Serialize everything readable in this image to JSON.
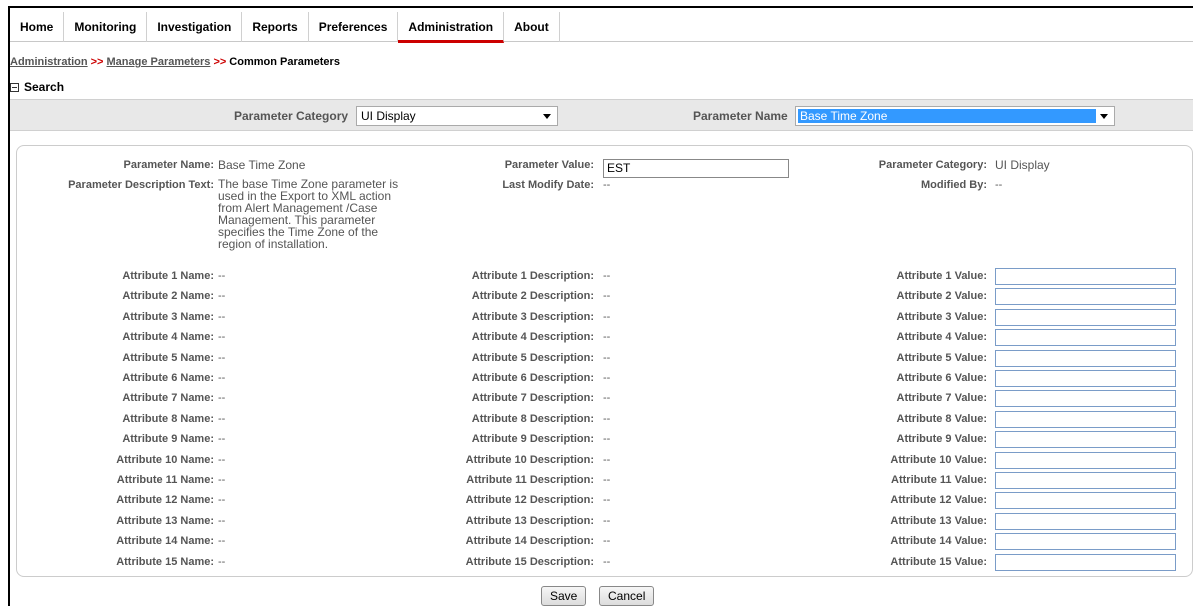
{
  "nav": {
    "items": [
      {
        "label": "Home"
      },
      {
        "label": "Monitoring"
      },
      {
        "label": "Investigation"
      },
      {
        "label": "Reports"
      },
      {
        "label": "Preferences"
      },
      {
        "label": "Administration",
        "active": true
      },
      {
        "label": "About"
      }
    ]
  },
  "breadcrumb": {
    "items": [
      "Administration",
      "Manage Parameters"
    ],
    "separator": ">>",
    "current": "Common Parameters"
  },
  "search": {
    "title": "Search",
    "category_label": "Parameter Category",
    "category_value": "UI Display",
    "name_label": "Parameter Name",
    "name_value": "Base Time Zone"
  },
  "details": {
    "param_name_label": "Parameter Name:",
    "param_name_value": "Base Time Zone",
    "param_value_label": "Parameter Value:",
    "param_value_value": "EST",
    "param_category_label": "Parameter Category:",
    "param_category_value": "UI Display",
    "desc_label": "Parameter Description Text:",
    "desc_value": "The base Time Zone parameter is used in the Export to XML action from Alert Management /Case Management. This parameter specifies the Time Zone of the region of installation.",
    "last_modify_label": "Last Modify Date:",
    "last_modify_value": "--",
    "modified_by_label": "Modified By:",
    "modified_by_value": "--"
  },
  "attributes": [
    {
      "name_label": "Attribute 1 Name:",
      "name_value": "--",
      "desc_label": "Attribute 1 Description:",
      "desc_value": "--",
      "value_label": "Attribute 1 Value:"
    },
    {
      "name_label": "Attribute 2 Name:",
      "name_value": "--",
      "desc_label": "Attribute 2 Description:",
      "desc_value": "--",
      "value_label": "Attribute 2 Value:"
    },
    {
      "name_label": "Attribute 3 Name:",
      "name_value": "--",
      "desc_label": "Attribute 3 Description:",
      "desc_value": "--",
      "value_label": "Attribute 3 Value:"
    },
    {
      "name_label": "Attribute 4 Name:",
      "name_value": "--",
      "desc_label": "Attribute 4 Description:",
      "desc_value": "--",
      "value_label": "Attribute 4 Value:"
    },
    {
      "name_label": "Attribute 5 Name:",
      "name_value": "--",
      "desc_label": "Attribute 5 Description:",
      "desc_value": "--",
      "value_label": "Attribute 5 Value:"
    },
    {
      "name_label": "Attribute 6 Name:",
      "name_value": "--",
      "desc_label": "Attribute 6 Description:",
      "desc_value": "--",
      "value_label": "Attribute 6 Value:"
    },
    {
      "name_label": "Attribute 7 Name:",
      "name_value": "--",
      "desc_label": "Attribute 7 Description:",
      "desc_value": "--",
      "value_label": "Attribute 7 Value:"
    },
    {
      "name_label": "Attribute 8 Name:",
      "name_value": "--",
      "desc_label": "Attribute 8 Description:",
      "desc_value": "--",
      "value_label": "Attribute 8 Value:"
    },
    {
      "name_label": "Attribute 9 Name:",
      "name_value": "--",
      "desc_label": "Attribute 9 Description:",
      "desc_value": "--",
      "value_label": "Attribute 9 Value:"
    },
    {
      "name_label": "Attribute 10 Name:",
      "name_value": "--",
      "desc_label": "Attribute 10 Description:",
      "desc_value": "--",
      "value_label": "Attribute 10 Value:"
    },
    {
      "name_label": "Attribute 11 Name:",
      "name_value": "--",
      "desc_label": "Attribute 11 Description:",
      "desc_value": "--",
      "value_label": "Attribute 11 Value:"
    },
    {
      "name_label": "Attribute 12 Name:",
      "name_value": "--",
      "desc_label": "Attribute 12 Description:",
      "desc_value": "--",
      "value_label": "Attribute 12 Value:"
    },
    {
      "name_label": "Attribute 13 Name:",
      "name_value": "--",
      "desc_label": "Attribute 13 Description:",
      "desc_value": "--",
      "value_label": "Attribute 13 Value:"
    },
    {
      "name_label": "Attribute 14 Name:",
      "name_value": "--",
      "desc_label": "Attribute 14 Description:",
      "desc_value": "--",
      "value_label": "Attribute 14 Value:"
    },
    {
      "name_label": "Attribute 15 Name:",
      "name_value": "--",
      "desc_label": "Attribute 15 Description:",
      "desc_value": "--",
      "value_label": "Attribute 15 Value:"
    }
  ],
  "actions": {
    "save_label": "Save",
    "cancel_label": "Cancel"
  },
  "colors": {
    "active_tab_underline": "#cc0000",
    "breadcrumb_separator": "#cc0000",
    "selection_highlight": "#3399ff"
  }
}
